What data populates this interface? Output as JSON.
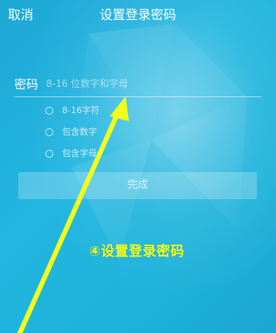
{
  "header": {
    "cancel_label": "取消",
    "title": "设置登录密码"
  },
  "password": {
    "label": "密码",
    "placeholder": "8-16 位数字和字母",
    "value": ""
  },
  "rules": [
    {
      "label": "8-16字符"
    },
    {
      "label": "包含数字"
    },
    {
      "label": "包含字母"
    }
  ],
  "actions": {
    "done_label": "完成"
  },
  "annotation": {
    "text": "④设置登录密码"
  },
  "colors": {
    "background": "#1fb3db",
    "annotation": "#f3ff1a",
    "text": "#ffffff"
  },
  "icons": {
    "rule_check": "circle-outline-icon",
    "annotation_arrow": "arrow-up-icon"
  }
}
